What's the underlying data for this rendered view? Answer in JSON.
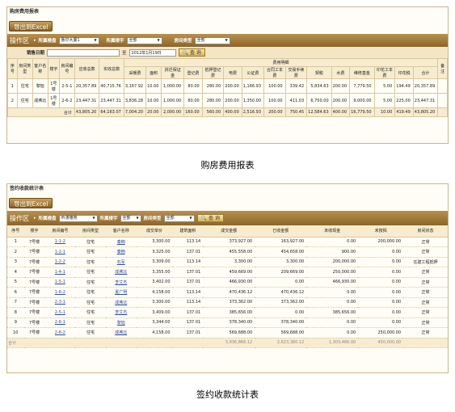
{
  "r1": {
    "title": "购房费用报表",
    "export": "导出到Excel",
    "area": "操作区",
    "proj_label": "所属楼盘",
    "proj_value": "鲁尔大厦1",
    "bld_label": "所属楼宇",
    "bld_value": "全部",
    "type_label": "房间类型",
    "type_value": "全部",
    "date_label": "销售日期",
    "to": "至",
    "date_value": "2012年1月19日",
    "query": "查 询",
    "h": {
      "seq": "序号",
      "rtype": "房间类型",
      "cust": "客户名称",
      "bld": "楼宇",
      "rno": "房间编号",
      "recv": "应收总数",
      "paid": "实收总数",
      "detail": "费用明细",
      "note": "备注"
    },
    "sub": [
      "采暖费",
      "面积",
      "拆迁保证金",
      "登记费",
      "抵押登记费",
      "电费",
      "公证费",
      "合同工本费",
      "交易手续费",
      "契税",
      "水费",
      "维修基金",
      "印花工本费",
      "印花税",
      "合计"
    ],
    "rows": [
      {
        "seq": "1",
        "rtype": "住宅",
        "cust": "黎旭",
        "bld": "1号楼",
        "rno": "2-5-1",
        "recv": "20,357.89",
        "paid": "40,715.76",
        "d": [
          "3,167.92",
          "10.00",
          "1,000.00",
          "80.00",
          "280.00",
          "200.00",
          "1,166.93",
          "100.00",
          "339.42",
          "5,834.63",
          "200.00",
          "7,779.50",
          "5.00",
          "194.49",
          "20,357.89"
        ]
      },
      {
        "seq": "2",
        "rtype": "住宅",
        "cust": "成弗比",
        "bld": "1号楼",
        "rno": "2-6-2",
        "recv": "23,447.31",
        "paid": "23,447.31",
        "d": [
          "3,836.28",
          "10.00",
          "1,000.00",
          "80.00",
          "280.00",
          "200.00",
          "1,350.00",
          "100.00",
          "411.03",
          "6,750.00",
          "200.00",
          "9,000.00",
          "5.00",
          "225.00",
          "23,447.31"
        ]
      }
    ],
    "sum": {
      "label": "合计",
      "recv": "43,805.20",
      "paid": "64,163.07",
      "d": [
        "7,004.20",
        "20.00",
        "2,000.00",
        "160.00",
        "560.00",
        "400.00",
        "2,516.93",
        "200.00",
        "750.45",
        "12,584.63",
        "400.00",
        "16,779.50",
        "10.00",
        "419.49",
        "43,805.20"
      ]
    },
    "caption": "购房费用报表"
  },
  "r2": {
    "title": "签约收款统计表",
    "export": "导出到Excel",
    "area": "操作区",
    "proj_label": "所属楼盘",
    "proj_value": "听涛雅苑",
    "bld_label": "所属楼宇",
    "bld_value": "全部",
    "type_label": "房间类型",
    "type_value": "全部",
    "query": "查 询",
    "h": [
      "序号",
      "楼宇",
      "房间编号",
      "房间类型",
      "客户名称",
      "成交单价",
      "建筑面积",
      "成交金额",
      "已收金额",
      "未收现金",
      "未按揭",
      "房间状态"
    ],
    "rows": [
      [
        "1",
        "7号楼",
        "1-1-2",
        "住宅",
        "秦楠",
        "3,300.00",
        "113.14",
        "373,927.00",
        "163,927.00",
        "0.00",
        "200,000.00",
        "正常"
      ],
      [
        "2",
        "7号楼",
        "1-2-1",
        "住宅",
        "秦楠",
        "3,325.00",
        "137.01",
        "455,558.00",
        "454,658.00",
        "900.00",
        "0.00",
        "正常"
      ],
      [
        "3",
        "7号楼",
        "1-2-2",
        "住宅",
        "石军",
        "3,309.00",
        "113.14",
        "3,300.00",
        "3,300.00",
        "200,000.00",
        "0.00",
        "在建工程抵押"
      ],
      [
        "4",
        "7号楼",
        "1-4-1",
        "住宅",
        "成弗比",
        "3,355.00",
        "137.01",
        "459,669.00",
        "209,669.00",
        "250,000.00",
        "0.00",
        "正常"
      ],
      [
        "5",
        "7号楼",
        "1-5-1",
        "住宅",
        "李艾杰",
        "3,402.00",
        "137.01",
        "466,930.00",
        "0.00",
        "466,930.00",
        "0.00",
        "正常"
      ],
      [
        "6",
        "7号楼",
        "1-6-2",
        "住宅",
        "夏广明",
        "4,158.00",
        "113.14",
        "470,436.12",
        "470,436.12",
        "0.00",
        "0.00",
        "正常"
      ],
      [
        "7",
        "7号楼",
        "2-3-1",
        "住宅",
        "成弗比",
        "3,300.00",
        "113.14",
        "373,362.00",
        "373,362.00",
        "0.00",
        "0.00",
        "正常"
      ],
      [
        "8",
        "7号楼",
        "2-5-1",
        "住宅",
        "李艾杰",
        "3,409.00",
        "137.01",
        "385,656.00",
        "0.00",
        "385,656.00",
        "0.00",
        "正常"
      ],
      [
        "9",
        "7号楼",
        "2-6-1",
        "住宅",
        "黎旭",
        "3,344.00",
        "137.01",
        "378,340.00",
        "378,340.00",
        "0.00",
        "0.00",
        "正常"
      ],
      [
        "10",
        "7号楼",
        "2-6-2",
        "住宅",
        "成弗比",
        "4,158.00",
        "137.01",
        "569,688.00",
        "569,688.00",
        "0.00",
        "250,000.00",
        "正常"
      ]
    ],
    "sum": {
      "label": "合计",
      "amt": "3,936,866.12",
      "recv": "2,623,380.12",
      "unpaid": "1,303,486.00",
      "nomort": "450,000.00"
    },
    "caption": "签约收款统计表"
  }
}
